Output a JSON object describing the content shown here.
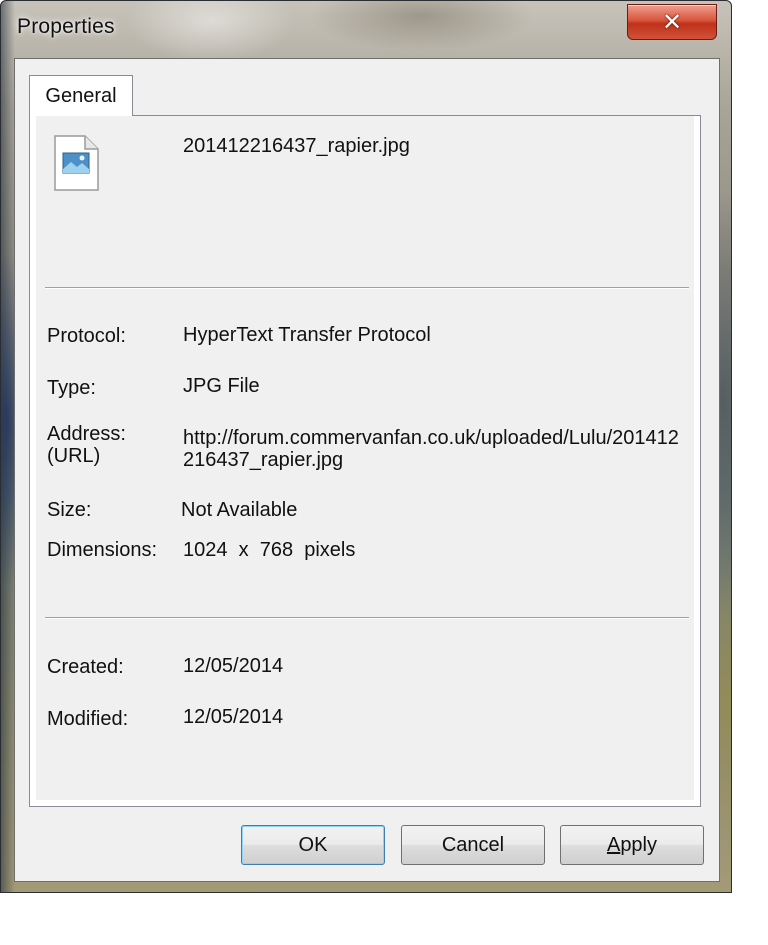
{
  "window": {
    "title": "Properties",
    "close_glyph": "✕"
  },
  "tabs": [
    {
      "label": "General",
      "active": true
    }
  ],
  "file": {
    "icon": "image-file-icon",
    "name": "201412216437_rapier.jpg"
  },
  "properties": {
    "protocol_label": "Protocol:",
    "protocol_value": "HyperText Transfer Protocol",
    "type_label": "Type:",
    "type_value": "JPG File",
    "address_label_line1": "Address:",
    "address_label_line2": "(URL)",
    "address_value": "http://forum.commervanfan.co.uk/uploaded/Lulu/201412216437_rapier.jpg",
    "size_label": "Size:",
    "size_value": "Not Available",
    "dimensions_label": "Dimensions:",
    "dimensions_value": "1024  x  768  pixels"
  },
  "dates": {
    "created_label": "Created:",
    "created_value": "12/05/2014",
    "modified_label": "Modified:",
    "modified_value": "12/05/2014"
  },
  "buttons": {
    "ok_label": "OK",
    "cancel_label": "Cancel",
    "apply_mnemonic": "A",
    "apply_rest": "pply"
  },
  "colors": {
    "close_red": "#c0311a",
    "focus_blue": "#3c7fb1",
    "dialog_bg": "#f0f0f0"
  }
}
